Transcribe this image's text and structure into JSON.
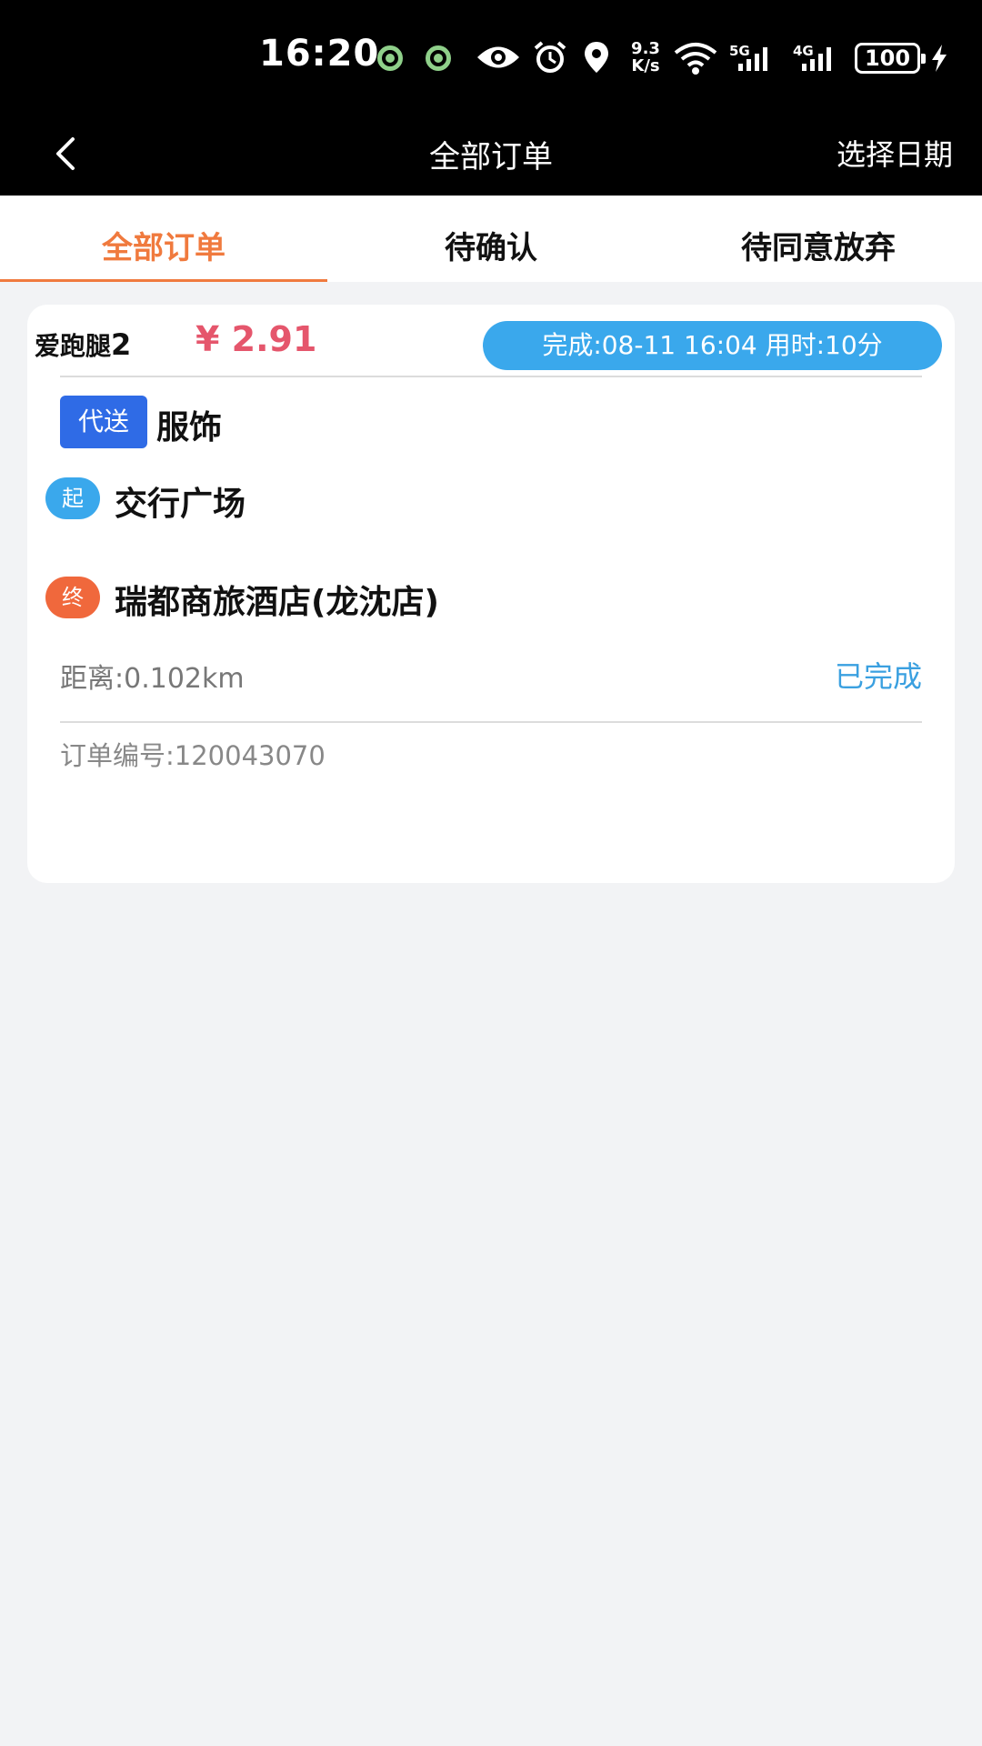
{
  "status_bar": {
    "time": "16:20",
    "net_speed_value": "9.3",
    "net_speed_unit": "K/s",
    "signal1": "5G",
    "signal2": "4G",
    "battery": "100",
    "icons": [
      "notification-icon",
      "notification-icon",
      "eye-icon",
      "alarm-icon",
      "location-icon",
      "wifi-icon",
      "signal-icon",
      "signal-icon",
      "battery-icon",
      "charging-icon"
    ]
  },
  "nav": {
    "title": "全部订单",
    "action": "选择日期"
  },
  "tabs": [
    {
      "label": "全部订单",
      "active": true
    },
    {
      "label": "待确认",
      "active": false
    },
    {
      "label": "待同意放弃",
      "active": false
    }
  ],
  "order": {
    "merchant": "爱跑腿",
    "merchant_num": "2",
    "price": "¥ 2.91",
    "finish_info": "完成:08-11 16:04 用时:10分",
    "type_tag": "代送",
    "category": "服饰",
    "start_icon": "起",
    "start_address": "交行广场",
    "end_icon": "终",
    "end_address": "瑞都商旅酒店(龙沈店)",
    "distance": "距离:0.102km",
    "status": "已完成",
    "order_number": "订单编号:120043070"
  },
  "colors": {
    "accent": "#f07a3e",
    "price": "#e5566c",
    "badge_blue": "#3aa8ec",
    "tag_blue": "#2f6be6",
    "end_orange": "#f0683c"
  }
}
